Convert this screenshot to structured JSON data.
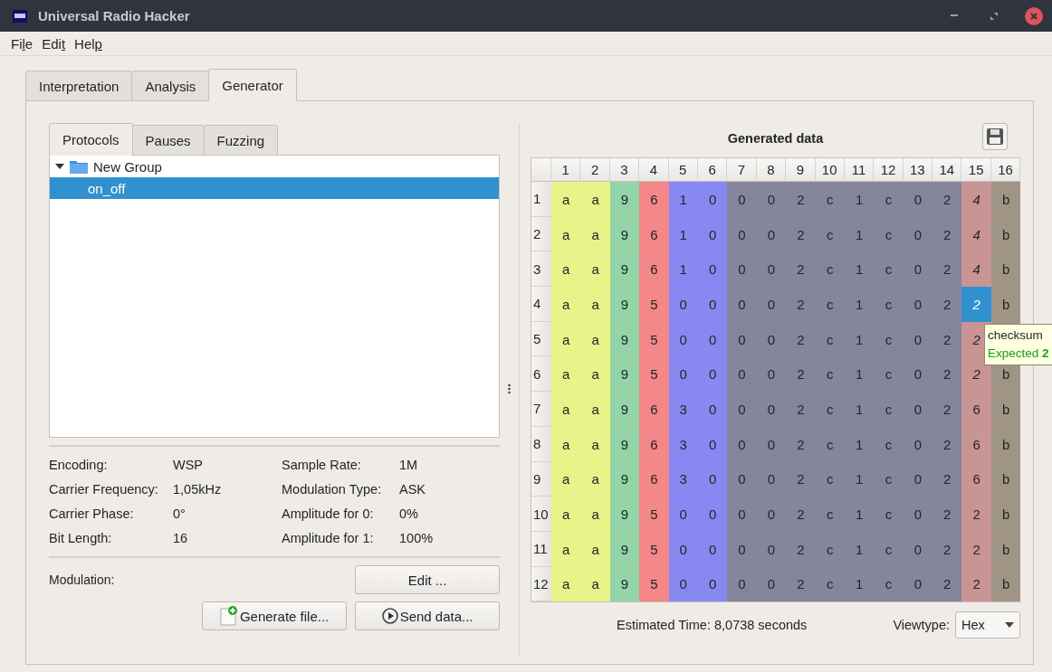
{
  "window": {
    "title": "Universal Radio Hacker"
  },
  "menu": [
    "File",
    "Edit",
    "Help"
  ],
  "main_tabs": [
    {
      "label": "Interpretation",
      "selected": false
    },
    {
      "label": "Analysis",
      "selected": false
    },
    {
      "label": "Generator",
      "selected": true
    }
  ],
  "left_tabs": [
    {
      "label": "Protocols",
      "selected": true
    },
    {
      "label": "Pauses",
      "selected": false
    },
    {
      "label": "Fuzzing",
      "selected": false
    }
  ],
  "tree": [
    {
      "label": "New Group",
      "expanded": true,
      "selected": false,
      "children": [
        {
          "label": "on_off",
          "selected": true
        }
      ]
    }
  ],
  "properties": [
    {
      "label": "Encoding:",
      "value": "WSP"
    },
    {
      "label": "Sample Rate:",
      "value": "1M"
    },
    {
      "label": "Carrier Frequency:",
      "value": "1,05kHz"
    },
    {
      "label": "Modulation Type:",
      "value": "ASK"
    },
    {
      "label": "Carrier Phase:",
      "value": "0°"
    },
    {
      "label": "Amplitude for 0:",
      "value": "0%"
    },
    {
      "label": "Bit Length:",
      "value": "16"
    },
    {
      "label": "Amplitude for 1:",
      "value": "100%"
    }
  ],
  "modulation": {
    "label": "Modulation:",
    "edit_button": "Edit ..."
  },
  "generate_button": "Generate file...",
  "send_button": "Send data...",
  "generated": {
    "title": "Generated data",
    "columns": [
      {
        "label": "1",
        "color": "#e8f48a"
      },
      {
        "label": "2",
        "color": "#e8f48a"
      },
      {
        "label": "3",
        "color": "#93d5a7"
      },
      {
        "label": "4",
        "color": "#f48787"
      },
      {
        "label": "5",
        "color": "#8888f2"
      },
      {
        "label": "6",
        "color": "#8888f2"
      },
      {
        "label": "7",
        "color": "#85859c"
      },
      {
        "label": "8",
        "color": "#85859c"
      },
      {
        "label": "9",
        "color": "#85859c"
      },
      {
        "label": "10",
        "color": "#85859c"
      },
      {
        "label": "11",
        "color": "#85859c"
      },
      {
        "label": "12",
        "color": "#85859c"
      },
      {
        "label": "13",
        "color": "#85859c"
      },
      {
        "label": "14",
        "color": "#85859c"
      },
      {
        "label": "15",
        "color": "#c89494"
      },
      {
        "label": "16",
        "color": "#a09484"
      }
    ],
    "rows": [
      {
        "label": "1",
        "cells": [
          "a",
          "a",
          "9",
          "6",
          "1",
          "0",
          "0",
          "0",
          "2",
          "c",
          "1",
          "c",
          "0",
          "2",
          "4",
          "b"
        ],
        "selected": false,
        "checksum_flagged": true
      },
      {
        "label": "2",
        "cells": [
          "a",
          "a",
          "9",
          "6",
          "1",
          "0",
          "0",
          "0",
          "2",
          "c",
          "1",
          "c",
          "0",
          "2",
          "4",
          "b"
        ],
        "selected": false,
        "checksum_flagged": true
      },
      {
        "label": "3",
        "cells": [
          "a",
          "a",
          "9",
          "6",
          "1",
          "0",
          "0",
          "0",
          "2",
          "c",
          "1",
          "c",
          "0",
          "2",
          "4",
          "b"
        ],
        "selected": false,
        "checksum_flagged": true
      },
      {
        "label": "4",
        "cells": [
          "a",
          "a",
          "9",
          "5",
          "0",
          "0",
          "0",
          "0",
          "2",
          "c",
          "1",
          "c",
          "0",
          "2",
          "2",
          "b"
        ],
        "selected": true,
        "checksum_flagged": true
      },
      {
        "label": "5",
        "cells": [
          "a",
          "a",
          "9",
          "5",
          "0",
          "0",
          "0",
          "0",
          "2",
          "c",
          "1",
          "c",
          "0",
          "2",
          "2"
        ],
        "selected": false,
        "checksum_flagged": true
      },
      {
        "label": "6",
        "cells": [
          "a",
          "a",
          "9",
          "5",
          "0",
          "0",
          "0",
          "0",
          "2",
          "c",
          "1",
          "c",
          "0",
          "2",
          "2",
          "b"
        ],
        "selected": false,
        "checksum_flagged": true
      },
      {
        "label": "7",
        "cells": [
          "a",
          "a",
          "9",
          "6",
          "3",
          "0",
          "0",
          "0",
          "2",
          "c",
          "1",
          "c",
          "0",
          "2",
          "6",
          "b"
        ],
        "selected": false,
        "checksum_flagged": false
      },
      {
        "label": "8",
        "cells": [
          "a",
          "a",
          "9",
          "6",
          "3",
          "0",
          "0",
          "0",
          "2",
          "c",
          "1",
          "c",
          "0",
          "2",
          "6",
          "b"
        ],
        "selected": false,
        "checksum_flagged": false
      },
      {
        "label": "9",
        "cells": [
          "a",
          "a",
          "9",
          "6",
          "3",
          "0",
          "0",
          "0",
          "2",
          "c",
          "1",
          "c",
          "0",
          "2",
          "6",
          "b"
        ],
        "selected": false,
        "checksum_flagged": false
      },
      {
        "label": "10",
        "cells": [
          "a",
          "a",
          "9",
          "5",
          "0",
          "0",
          "0",
          "0",
          "2",
          "c",
          "1",
          "c",
          "0",
          "2",
          "2",
          "b"
        ],
        "selected": false,
        "checksum_flagged": false
      },
      {
        "label": "11",
        "cells": [
          "a",
          "a",
          "9",
          "5",
          "0",
          "0",
          "0",
          "0",
          "2",
          "c",
          "1",
          "c",
          "0",
          "2",
          "2",
          "b"
        ],
        "selected": false,
        "checksum_flagged": false
      },
      {
        "label": "12",
        "cells": [
          "a",
          "a",
          "9",
          "5",
          "0",
          "0",
          "0",
          "0",
          "2",
          "c",
          "1",
          "c",
          "0",
          "2",
          "2",
          "b"
        ],
        "selected": false,
        "checksum_flagged": false
      }
    ],
    "tooltip": {
      "title": "checksum",
      "detail": "Expected **2**"
    },
    "estimated_time": "Estimated Time: 8,0738 seconds",
    "viewtype": {
      "label": "Viewtype:",
      "value": "Hex"
    }
  }
}
